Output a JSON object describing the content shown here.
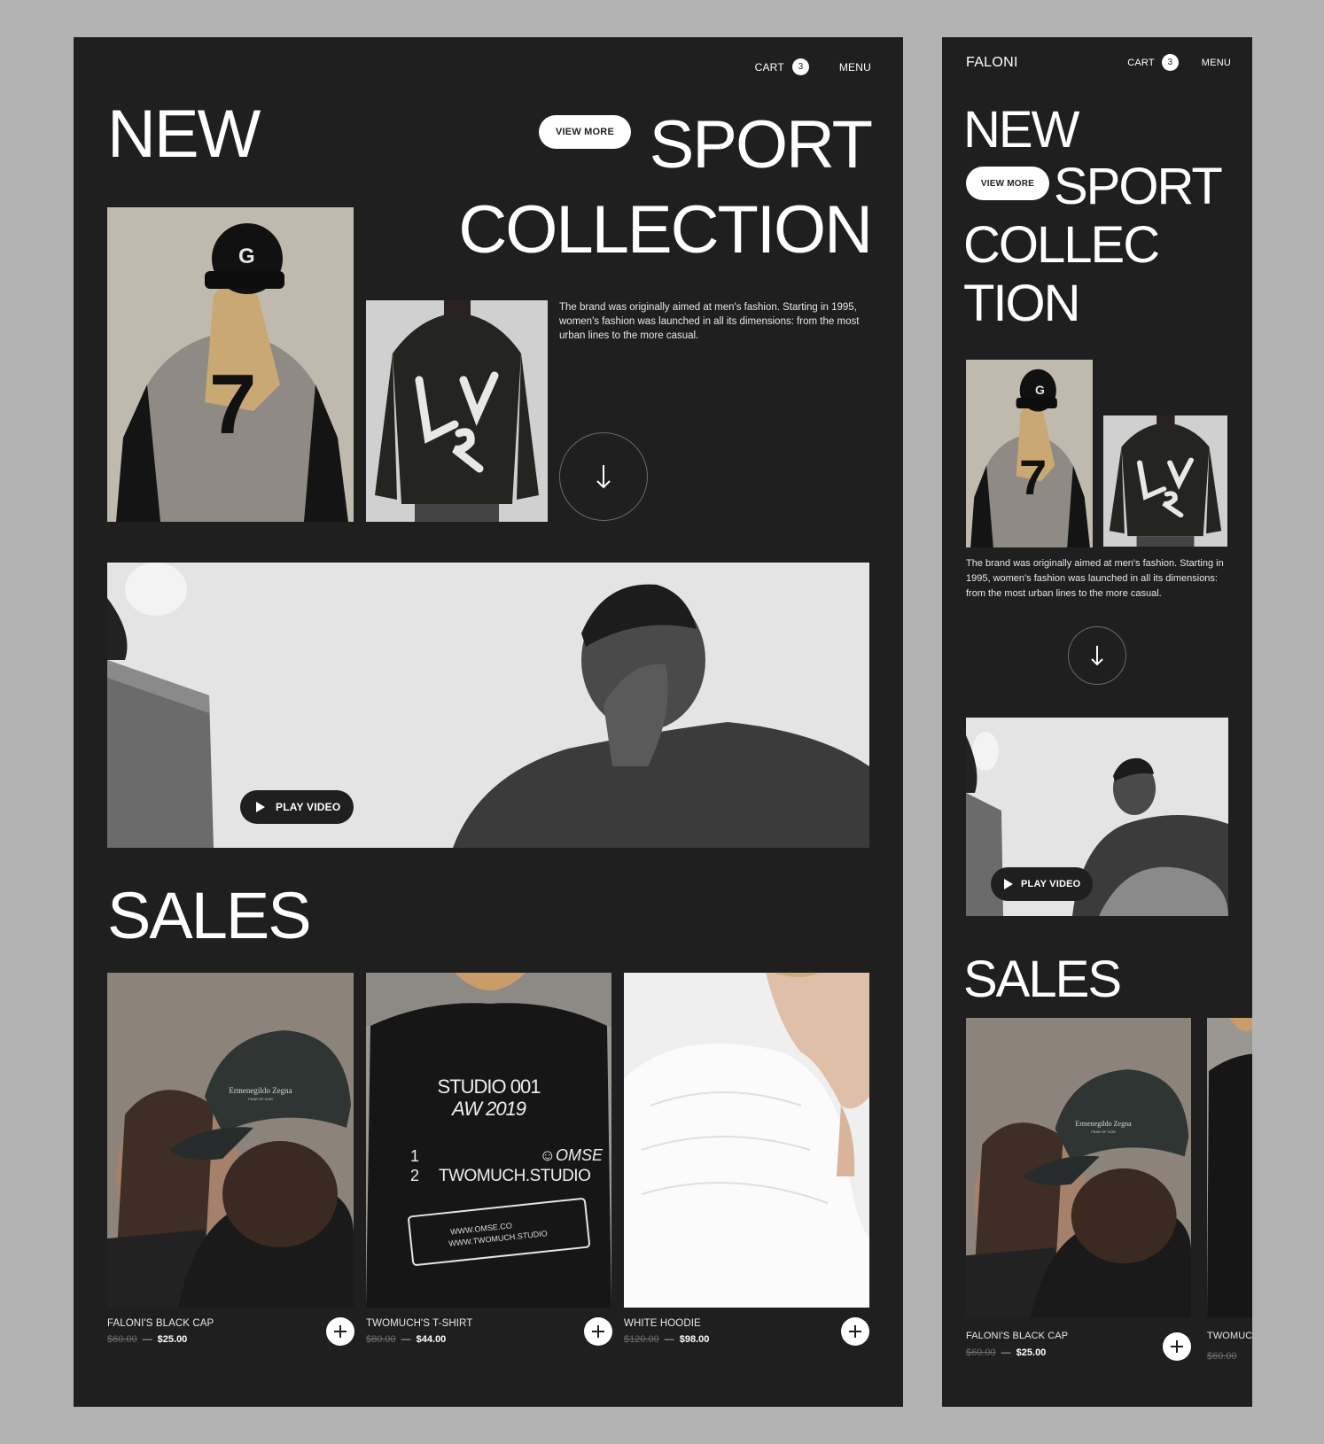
{
  "brand": "FALONI",
  "nav": {
    "cart_label": "CART",
    "cart_count": "3",
    "menu_label": "MENU"
  },
  "hero": {
    "word_new": "NEW",
    "word_sport": "SPORT",
    "word_collection": "COLLECTION",
    "mobile_collec": "COLLEC",
    "mobile_tion": "TION",
    "view_more": "VIEW MORE",
    "description": "The brand was originally aimed at men's fashion. Starting in 1995, women's fashion was launched in all its dimensions: from the most urban lines to the more casual."
  },
  "video": {
    "play_label": "PLAY VIDEO"
  },
  "sales": {
    "title": "SALES",
    "products": [
      {
        "name": "FALONI'S BLACK CAP",
        "old_price": "$60.00",
        "separator": "—",
        "new_price": "$25.00"
      },
      {
        "name": "TWOMUCH'S T-SHIRT",
        "old_price": "$80.00",
        "separator": "—",
        "new_price": "$44.00"
      },
      {
        "name": "WHITE HOODIE",
        "old_price": "$120.00",
        "separator": "—",
        "new_price": "$98.00"
      }
    ],
    "mobile_partial": {
      "name": "TWOMUC",
      "old_price": "$60.00"
    }
  },
  "photo_text": {
    "jersey_number": "7",
    "cap_letter": "G",
    "tee_studio": "STUDIO 001",
    "tee_season": "AW 2019",
    "tee_num_1": "1",
    "tee_num_2": "2",
    "tee_brand": "TWOMUCH.STUDIO",
    "tee_omse": "☺OMSE",
    "tee_url_1": "WWW.OMSE.CO",
    "tee_url_2": "WWW.TWOMUCH.STUDIO",
    "cap_logo": "Ermenegildo Zegna",
    "cap_logo_sub": "FEAR OF GOD"
  },
  "colors": {
    "page_bg": "#b3b3b3",
    "frame_bg": "#1f1f20",
    "text": "#ffffff",
    "muted": "#6d6d6d"
  }
}
